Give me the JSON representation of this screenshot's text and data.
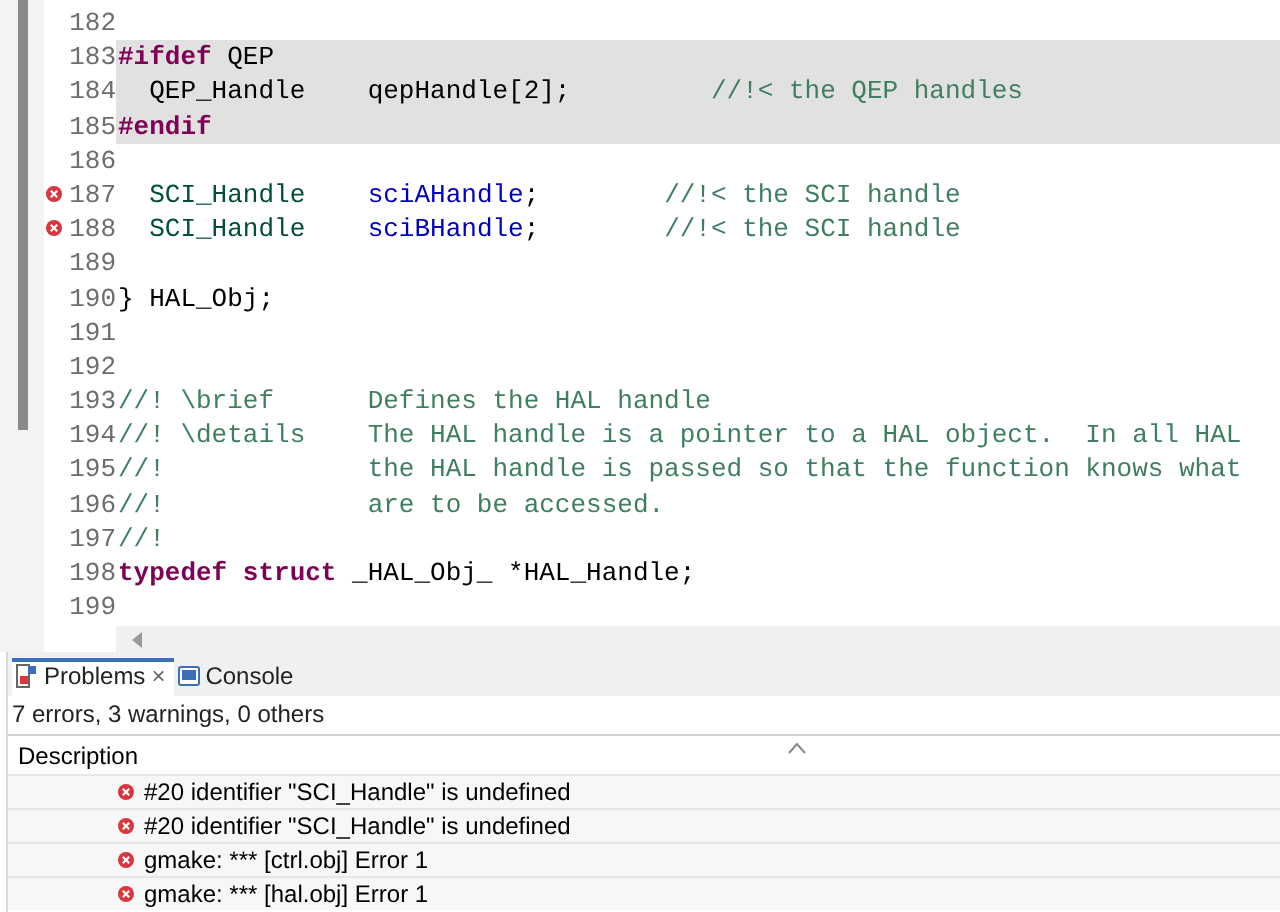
{
  "editor": {
    "lines": [
      {
        "number": "182",
        "error": false,
        "inactive": false
      },
      {
        "number": "183",
        "error": false,
        "inactive": true,
        "segments": [
          {
            "kind": "keyword",
            "text": "#ifdef"
          },
          {
            "kind": "plain",
            "text": " QEP"
          }
        ]
      },
      {
        "number": "184",
        "error": false,
        "inactive": true,
        "segments": [
          {
            "kind": "plain",
            "text": "  QEP_Handle    qepHandle[2];"
          },
          {
            "kind": "comment",
            "text": "         //!< the QEP handles"
          }
        ]
      },
      {
        "number": "185",
        "error": false,
        "inactive": true,
        "segments": [
          {
            "kind": "keyword",
            "text": "#endif"
          }
        ]
      },
      {
        "number": "186",
        "error": false,
        "inactive": false
      },
      {
        "number": "187",
        "error": true,
        "inactive": false,
        "segments": [
          {
            "kind": "type",
            "text": "  SCI_Handle"
          },
          {
            "kind": "field",
            "text": "    sciAHandle"
          },
          {
            "kind": "plain",
            "text": ";"
          },
          {
            "kind": "comment",
            "text": "        //!< the SCI handle"
          }
        ]
      },
      {
        "number": "188",
        "error": true,
        "inactive": false,
        "segments": [
          {
            "kind": "type",
            "text": "  SCI_Handle"
          },
          {
            "kind": "field",
            "text": "    sciBHandle"
          },
          {
            "kind": "plain",
            "text": ";"
          },
          {
            "kind": "comment",
            "text": "        //!< the SCI handle"
          }
        ]
      },
      {
        "number": "189",
        "error": false,
        "inactive": false
      },
      {
        "number": "190",
        "error": false,
        "inactive": false,
        "segments": [
          {
            "kind": "plain",
            "text": "} HAL_Obj;"
          }
        ]
      },
      {
        "number": "191",
        "error": false,
        "inactive": false
      },
      {
        "number": "192",
        "error": false,
        "inactive": false
      },
      {
        "number": "193",
        "error": false,
        "inactive": false,
        "segments": [
          {
            "kind": "comment",
            "text": "//! \\brief      Defines the HAL handle"
          }
        ]
      },
      {
        "number": "194",
        "error": false,
        "inactive": false,
        "segments": [
          {
            "kind": "comment",
            "text": "//! \\details    The HAL handle is a pointer to a HAL object.  In all HAL"
          }
        ]
      },
      {
        "number": "195",
        "error": false,
        "inactive": false,
        "segments": [
          {
            "kind": "comment",
            "text": "//!             the HAL handle is passed so that the function knows what"
          }
        ]
      },
      {
        "number": "196",
        "error": false,
        "inactive": false,
        "segments": [
          {
            "kind": "comment",
            "text": "//!             are to be accessed."
          }
        ]
      },
      {
        "number": "197",
        "error": false,
        "inactive": false,
        "segments": [
          {
            "kind": "comment",
            "text": "//!"
          }
        ]
      },
      {
        "number": "198",
        "error": false,
        "inactive": false,
        "segments": [
          {
            "kind": "keyword",
            "text": "typedef struct"
          },
          {
            "kind": "plain",
            "text": " _HAL_Obj_ *HAL_Handle;"
          }
        ]
      },
      {
        "number": "199",
        "error": false,
        "inactive": false
      }
    ]
  },
  "panel": {
    "tabs": [
      {
        "kind": "problems",
        "label": "Problems",
        "selected": true,
        "close": "×"
      },
      {
        "kind": "console",
        "label": "Console",
        "selected": false
      }
    ],
    "summary": "7 errors, 3 warnings, 0 others",
    "column": "Description",
    "problems": [
      {
        "kind": "error",
        "text": "#20 identifier \"SCI_Handle\" is undefined"
      },
      {
        "kind": "error",
        "text": "#20 identifier \"SCI_Handle\" is undefined"
      },
      {
        "kind": "error",
        "text": "gmake: *** [ctrl.obj] Error 1"
      },
      {
        "kind": "error",
        "text": "gmake: *** [hal.obj] Error 1"
      }
    ]
  }
}
